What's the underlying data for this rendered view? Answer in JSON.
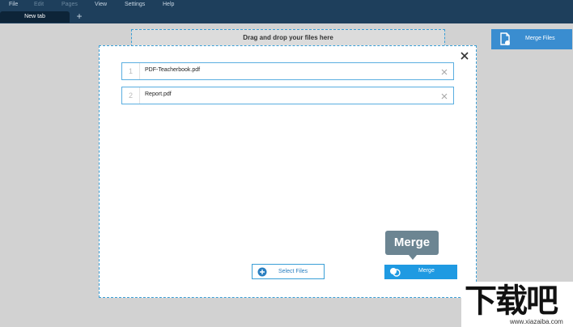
{
  "menubar": {
    "items": [
      {
        "label": "File",
        "enabled": true
      },
      {
        "label": "Edit",
        "enabled": false
      },
      {
        "label": "Pages",
        "enabled": false
      },
      {
        "label": "View",
        "enabled": true
      },
      {
        "label": "Settings",
        "enabled": true
      },
      {
        "label": "Help",
        "enabled": true
      }
    ]
  },
  "tabs": {
    "active_label": "New tab",
    "add_symbol": "+"
  },
  "workspace": {
    "drop_hint": "Drag and drop your files here",
    "merge_files_label": "Merge Files"
  },
  "dialog": {
    "files": [
      {
        "index": "1",
        "name": "PDF-Teacherbook.pdf"
      },
      {
        "index": "2",
        "name": "Report.pdf"
      }
    ],
    "select_files_label": "Select Files",
    "merge_label": "Merge",
    "tooltip": "Merge"
  },
  "watermark": {
    "brand": "下载吧",
    "url": "www.xiazaiba.com"
  },
  "colors": {
    "menubar_bg": "#1e3f5c",
    "accent": "#1f9ae2",
    "dashed_border": "#3a9fd6",
    "tooltip_bg": "#6c8592"
  }
}
